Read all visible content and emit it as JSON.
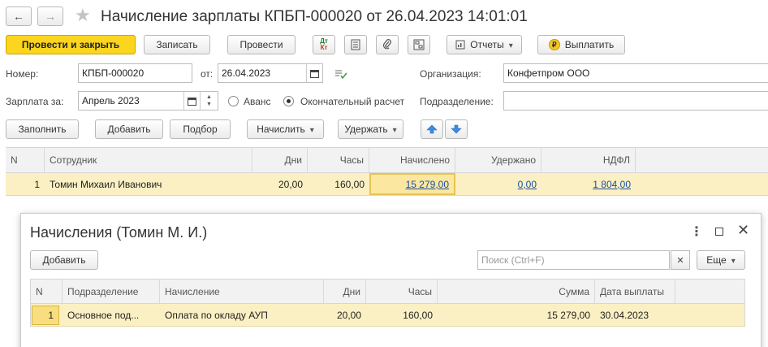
{
  "window": {
    "title": "Начисление зарплаты КПБП-000020 от 26.04.2023 14:01:01"
  },
  "toolbar": {
    "post_close": "Провести и закрыть",
    "save": "Записать",
    "post": "Провести",
    "reports": "Отчеты",
    "pay": "Выплатить",
    "dt_kt_top": "Дт",
    "dt_kt_bottom": "Кт"
  },
  "form": {
    "number_label": "Номер:",
    "number_value": "КПБП-000020",
    "date_label": "от:",
    "date_value": "26.04.2023",
    "org_label": "Организация:",
    "org_value": "Конфетпром ООО",
    "salary_for_label": "Зарплата за:",
    "salary_for_value": "Апрель 2023",
    "advance_label": "Аванс",
    "final_label": "Окончательный расчет",
    "division_label": "Подразделение:",
    "division_value": ""
  },
  "actions": {
    "fill": "Заполнить",
    "add": "Добавить",
    "select": "Подбор",
    "accrue": "Начислить",
    "withhold": "Удержать"
  },
  "main_table": {
    "headers": [
      "N",
      "Сотрудник",
      "Дни",
      "Часы",
      "Начислено",
      "Удержано",
      "НДФЛ"
    ],
    "rows": [
      {
        "n": "1",
        "employee": "Томин Михаил Иванович",
        "days": "20,00",
        "hours": "160,00",
        "accrued": "15 279,00",
        "withheld": "0,00",
        "ndfl": "1 804,00"
      }
    ]
  },
  "subform": {
    "title": "Начисления (Томин М. И.)",
    "add": "Добавить",
    "search_placeholder": "Поиск (Ctrl+F)",
    "more": "Еще",
    "headers": [
      "N",
      "Подразделение",
      "Начисление",
      "Дни",
      "Часы",
      "Сумма",
      "Дата выплаты"
    ],
    "rows": [
      {
        "n": "1",
        "division": "Основное под...",
        "accrual": "Оплата по окладу АУП",
        "days": "20,00",
        "hours": "160,00",
        "sum": "15 279,00",
        "pay_date": "30.04.2023"
      }
    ]
  },
  "colors": {
    "primary_button": "#fbd51e",
    "row_selected": "#fbf0c3",
    "link": "#1a4fa8",
    "arrow_blue": "#3d8be0"
  }
}
